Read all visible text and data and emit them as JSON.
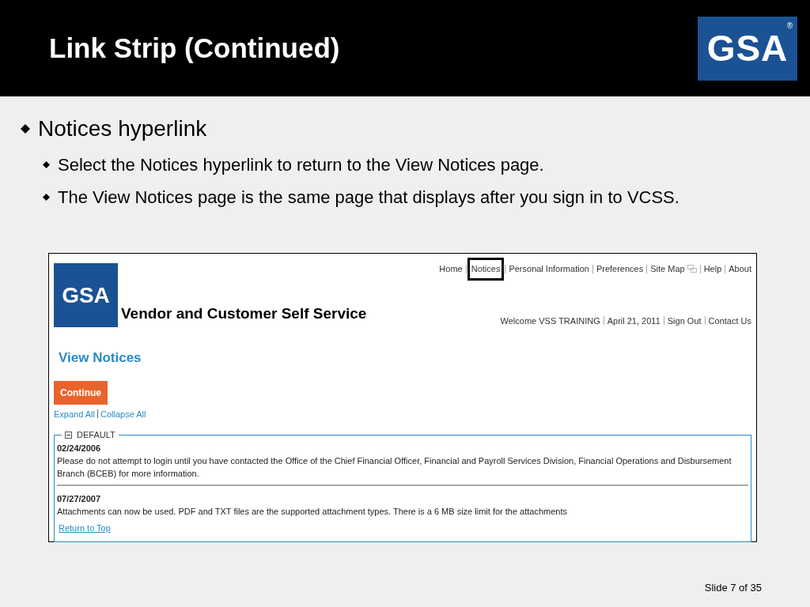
{
  "slide": {
    "title": "Link Strip (Continued)",
    "logo": {
      "text": "GSA",
      "mark": "®"
    },
    "footer": "Slide 7 of 35"
  },
  "bullets": [
    {
      "text": "Notices hyperlink",
      "children": [
        {
          "text": "Select the Notices hyperlink to return to the View Notices page."
        },
        {
          "text": "The View Notices page is the same page that displays after you sign in to VCSS."
        }
      ]
    }
  ],
  "screenshot": {
    "logo": "GSA",
    "site_title": "Vendor and Customer Self Service",
    "nav_links": [
      {
        "label": "Home",
        "highlighted": false,
        "kind": "link"
      },
      {
        "label": "Notices",
        "highlighted": true,
        "kind": "link"
      },
      {
        "label": "Personal Information",
        "highlighted": false,
        "kind": "link"
      },
      {
        "label": "Preferences",
        "highlighted": false,
        "kind": "link"
      },
      {
        "label": "Site Map",
        "highlighted": false,
        "kind": "sitemap"
      },
      {
        "label": "Help",
        "highlighted": false,
        "kind": "link"
      },
      {
        "label": "About",
        "highlighted": false,
        "kind": "link"
      }
    ],
    "user_links": [
      "Welcome VSS TRAINING",
      "April 21, 2011",
      "Sign Out",
      "Contact Us"
    ],
    "page_title": "View Notices",
    "continue_button": "Continue",
    "expand_all": "Expand All",
    "collapse_all": "Collapse All",
    "section": {
      "title": "DEFAULT",
      "expanded": true,
      "notices": [
        {
          "date": "02/24/2006",
          "text": "Please do not attempt to login until you have contacted the Office of the Chief Financial Officer, Financial and Payroll Services Division, Financial Operations and Disbursement Branch (BCEB) for more information."
        },
        {
          "date": "07/27/2007",
          "text": "Attachments can now be used. PDF and TXT files are the supported attachment types. There is a 6 MB size limit for the attachments"
        }
      ],
      "return_link": "Return to Top"
    }
  }
}
